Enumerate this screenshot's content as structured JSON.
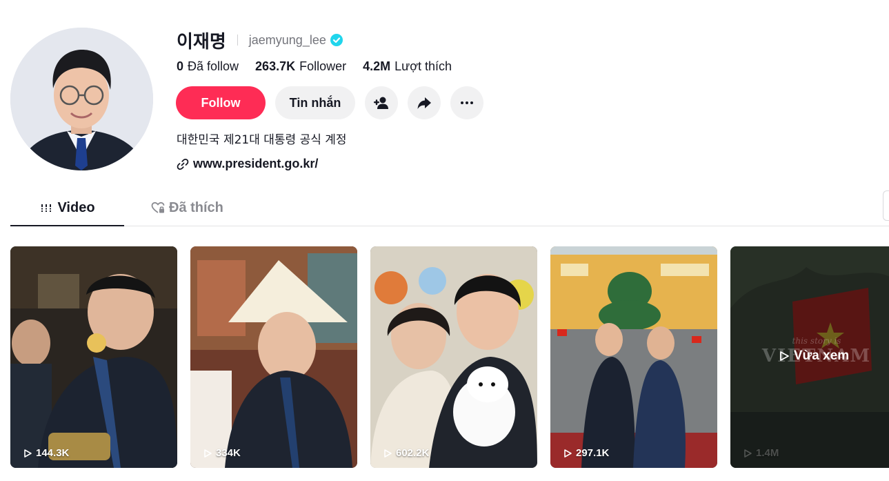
{
  "profile": {
    "display_name": "이재명",
    "username": "jaemyung_lee",
    "verified": true,
    "avatar_icon": "profile-photo"
  },
  "stats": {
    "following": {
      "value": "0",
      "label": "Đã follow"
    },
    "followers": {
      "value": "263.7K",
      "label": "Follower"
    },
    "likes": {
      "value": "4.2M",
      "label": "Lượt thích"
    }
  },
  "actions": {
    "follow_label": "Follow",
    "message_label": "Tin nhắn",
    "add_friend_icon": "add-user-icon",
    "share_icon": "share-icon",
    "more_icon": "more-icon"
  },
  "bio": "대한민국 제21대 대통령 공식 계정",
  "link": {
    "text": "www.president.go.kr/",
    "icon": "link-icon"
  },
  "tabs": [
    {
      "label": "Video",
      "icon": "grid-icon",
      "active": true
    },
    {
      "label": "Đã thích",
      "icon": "heart-lock-icon",
      "active": false
    }
  ],
  "videos": [
    {
      "views": "144.3K",
      "watched": false
    },
    {
      "views": "334K",
      "watched": false
    },
    {
      "views": "602.2K",
      "watched": false
    },
    {
      "views": "297.1K",
      "watched": false
    },
    {
      "views": "1.4M",
      "watched": true,
      "watched_label": "Vừa xem",
      "overlay_small": "this story is",
      "overlay_big": "VIETNAM"
    }
  ],
  "colors": {
    "follow_button": "#fe2c55",
    "verified_badge": "#20d5ec",
    "secondary_button": "#f1f1f2",
    "muted_text": "#73747b"
  }
}
